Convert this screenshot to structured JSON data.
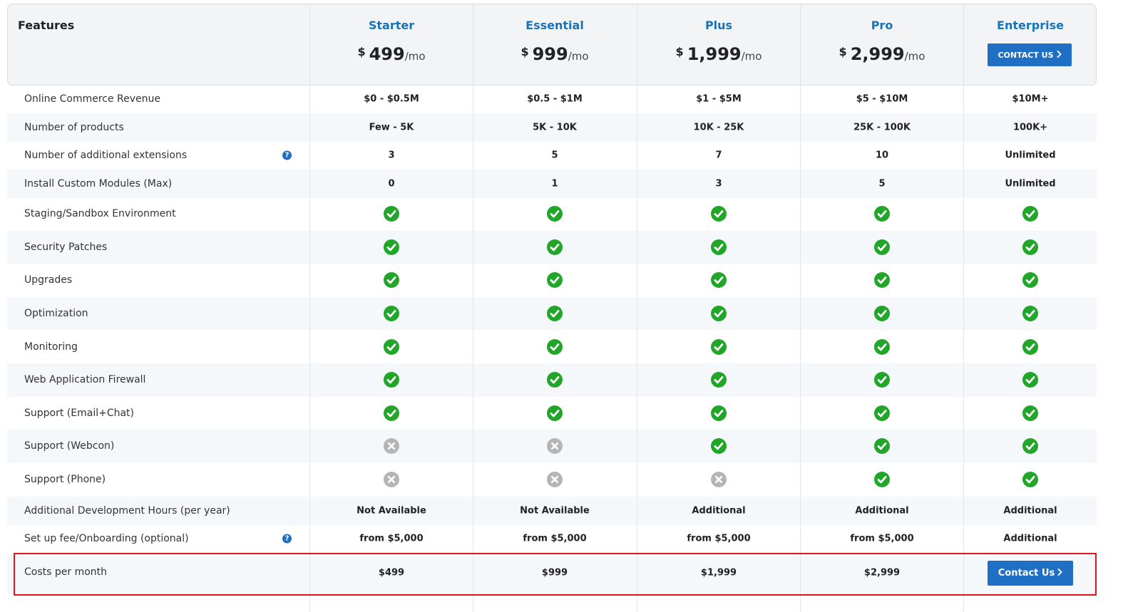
{
  "header": {
    "features_label": "Features",
    "plans": [
      {
        "name": "Starter",
        "currency": "$",
        "amount": "499",
        "period": "/mo"
      },
      {
        "name": "Essential",
        "currency": "$",
        "amount": "999",
        "period": "/mo"
      },
      {
        "name": "Plus",
        "currency": "$",
        "amount": "1,999",
        "period": "/mo"
      },
      {
        "name": "Pro",
        "currency": "$",
        "amount": "2,999",
        "period": "/mo"
      },
      {
        "name": "Enterprise",
        "contact_label": "CONTACT US",
        "contact_icon": "chevron-right-icon"
      }
    ]
  },
  "rows": [
    {
      "label": "Online Commerce Revenue",
      "values": [
        "$0 - $0.5M",
        "$0.5 - $1M",
        "$1 - $5M",
        "$5 - $10M",
        "$10M+"
      ]
    },
    {
      "label": "Number of products",
      "values": [
        "Few - 5K",
        "5K - 10K",
        "10K - 25K",
        "25K - 100K",
        "100K+"
      ]
    },
    {
      "label": "Number of additional extensions",
      "help": "?",
      "values": [
        "3",
        "5",
        "7",
        "10",
        "Unlimited"
      ]
    },
    {
      "label": "Install Custom Modules (Max)",
      "values": [
        "0",
        "1",
        "3",
        "5",
        "Unlimited"
      ]
    },
    {
      "label": "Staging/Sandbox Environment",
      "checks": [
        "yes",
        "yes",
        "yes",
        "yes",
        "yes"
      ]
    },
    {
      "label": "Security Patches",
      "checks": [
        "yes",
        "yes",
        "yes",
        "yes",
        "yes"
      ]
    },
    {
      "label": "Upgrades",
      "checks": [
        "yes",
        "yes",
        "yes",
        "yes",
        "yes"
      ]
    },
    {
      "label": "Optimization",
      "checks": [
        "yes",
        "yes",
        "yes",
        "yes",
        "yes"
      ]
    },
    {
      "label": "Monitoring",
      "checks": [
        "yes",
        "yes",
        "yes",
        "yes",
        "yes"
      ]
    },
    {
      "label": "Web Application Firewall",
      "checks": [
        "yes",
        "yes",
        "yes",
        "yes",
        "yes"
      ]
    },
    {
      "label": "Support (Email+Chat)",
      "checks": [
        "yes",
        "yes",
        "yes",
        "yes",
        "yes"
      ]
    },
    {
      "label": "Support (Webcon)",
      "checks": [
        "no",
        "no",
        "yes",
        "yes",
        "yes"
      ]
    },
    {
      "label": "Support (Phone)",
      "checks": [
        "no",
        "no",
        "no",
        "yes",
        "yes"
      ]
    },
    {
      "label": "Additional Development Hours (per year)",
      "values": [
        "Not Available",
        "Not Available",
        "Additional",
        "Additional",
        "Additional"
      ]
    },
    {
      "label": "Set up fee/Onboarding (optional)",
      "help": "?",
      "values": [
        "from $5,000",
        "from $5,000",
        "from $5,000",
        "from $5,000",
        "Additional"
      ]
    }
  ],
  "costs": {
    "label": "Costs per month",
    "values": [
      "$499",
      "$999",
      "$1,999",
      "$2,999"
    ],
    "contact_label": "Contact Us",
    "contact_icon": "chevron-right-icon"
  },
  "colors": {
    "accent_blue": "#1f6fc5",
    "plan_name_blue": "#1a73b8",
    "check_green": "#22a62a",
    "cross_gray": "#b5b5b5",
    "highlight_red": "#e3131b"
  }
}
